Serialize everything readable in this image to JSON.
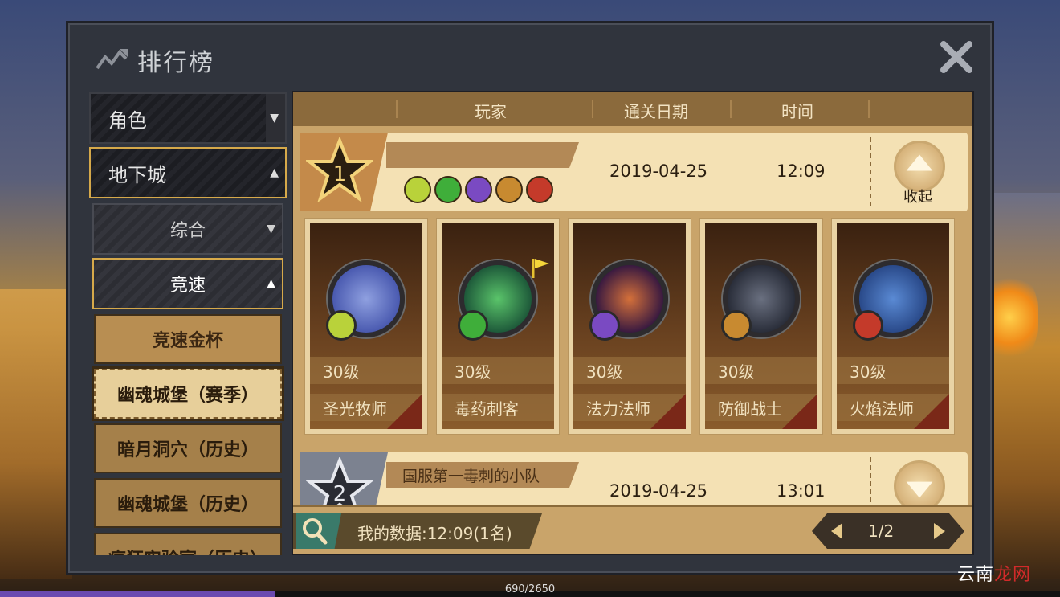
{
  "window": {
    "title": "排行榜"
  },
  "menu": {
    "category_role": "角色",
    "category_dungeon": "地下城",
    "sub_overall": "综合",
    "sub_speed": "竞速",
    "leaf_items": [
      "竞速金杯",
      "幽魂城堡（赛季）",
      "暗月洞穴（历史）",
      "幽魂城堡（历史）",
      "疯狂实验室（历史）"
    ]
  },
  "table": {
    "headers": {
      "player": "玩家",
      "clear_date": "通关日期",
      "time": "时间"
    }
  },
  "rows": [
    {
      "rank": "1",
      "team_name": "",
      "date": "2019-04-25",
      "time": "12:09",
      "collapse_label": "收起",
      "heroes": [
        {
          "level": "30级",
          "class": "圣光牧师",
          "color": "#b9d23a"
        },
        {
          "level": "30级",
          "class": "毒药刺客",
          "color": "#3fae3a"
        },
        {
          "level": "30级",
          "class": "法力法师",
          "color": "#7a4ac2"
        },
        {
          "level": "30级",
          "class": "防御战士",
          "color": "#c88a30"
        },
        {
          "level": "30级",
          "class": "火焰法师",
          "color": "#c43a2a"
        }
      ]
    },
    {
      "rank": "2",
      "team_name": "国服第一毒刺的小队",
      "date": "2019-04-25",
      "time": "13:01"
    }
  ],
  "footer": {
    "my_data": "我的数据:12:09(1名)",
    "pager": "1/2"
  },
  "bottom": {
    "progress_text": "690/2650",
    "progress_fraction": 0.26
  },
  "watermark": {
    "part1": "云南",
    "part2": "龙网"
  }
}
